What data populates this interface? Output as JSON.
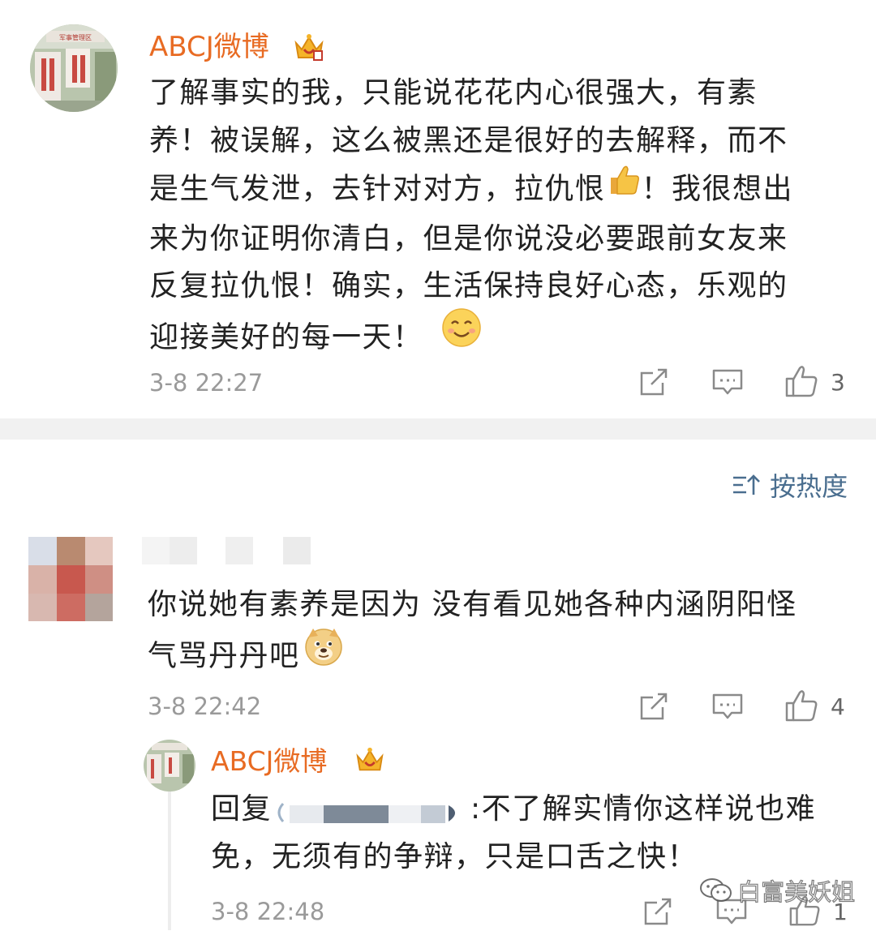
{
  "comment1": {
    "username": "ABCJ微博",
    "avatar_sign_text": "军事管理区",
    "lines": [
      "了解事实的我，只能说花花内心很强大，有素",
      "养！被误解，这么被黑还是很好的去解释，而不",
      "是生气发泄，去针对对方，拉仇恨",
      "！我很想出",
      "来为你证明你清白，但是你说没必要跟前女友来",
      "反复拉仇恨！确实，生活保持良好心态，乐观的",
      "迎接美好的每一天！"
    ],
    "time": "3-8 22:27",
    "likes": "3",
    "icons": [
      "share-icon",
      "comment-icon",
      "like-icon",
      "crown-icon",
      "thumbs-up-emoji",
      "smile-emoji"
    ]
  },
  "sort": {
    "label": "按热度",
    "icon": "sort-icon"
  },
  "comment2": {
    "lines": [
      "你说她有素养是因为 没有看见她各种内涵阴阳怪",
      "气骂丹丹吧"
    ],
    "time": "3-8 22:42",
    "likes": "4",
    "icons": [
      "doge-emoji"
    ]
  },
  "reply": {
    "username": "ABCJ微博",
    "prefix": "回复",
    "line1_rest": ":不了解实情你这样说也难",
    "line2": "免，无须有的争辩，只是口舌之快！",
    "time": "3-8 22:48",
    "likes": "1"
  },
  "watermark": "白富美妖姐",
  "colors": {
    "name": "#e86b23",
    "text": "#222222",
    "meta": "#9a9a9a",
    "sort": "#4a6e8f",
    "separator": "#f1f1f1"
  }
}
